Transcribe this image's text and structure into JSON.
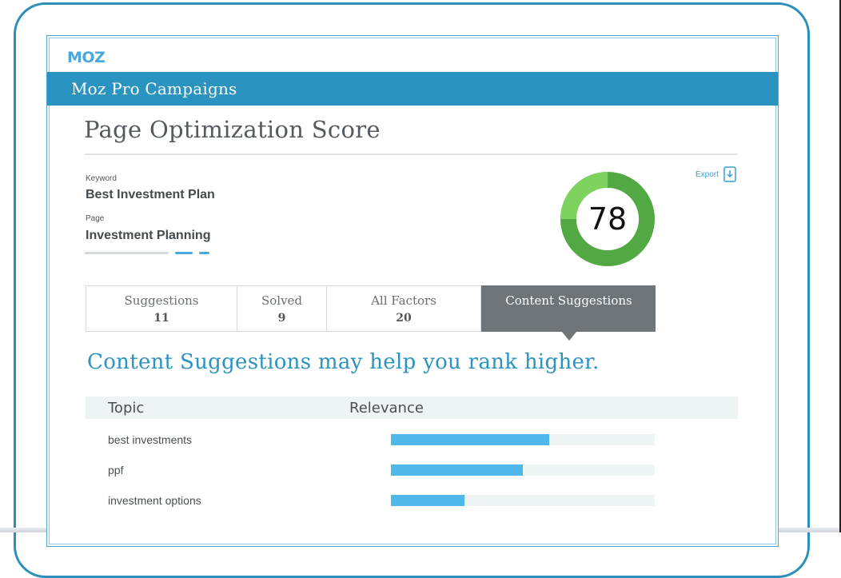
{
  "logo": "MOZ",
  "app_bar": {
    "title": "Moz Pro Campaigns"
  },
  "page_title": "Page Optimization Score",
  "export_label": "Export",
  "keyword": {
    "label": "Keyword",
    "value": "Best Investment Plan"
  },
  "page": {
    "label": "Page",
    "value": "Investment Planning"
  },
  "score": {
    "value": 78,
    "max": 100,
    "ring_color": "#52a944",
    "highlight_color": "#7ed35f"
  },
  "tabs": [
    {
      "label": "Suggestions",
      "count": "11"
    },
    {
      "label": "Solved",
      "count": "9"
    },
    {
      "label": "All Factors",
      "count": "20"
    },
    {
      "label": "Content Suggestions",
      "count": "",
      "active": true
    }
  ],
  "headline": "Content Suggestions may help you rank higher.",
  "table": {
    "headers": {
      "topic": "Topic",
      "relevance": "Relevance"
    },
    "rows": [
      {
        "topic": "best investments",
        "relevance": 0.6
      },
      {
        "topic": "ppf",
        "relevance": 0.5
      },
      {
        "topic": "investment options",
        "relevance": 0.28
      }
    ]
  },
  "colors": {
    "brand": "#2a93c0",
    "bar": "#4fb8e8",
    "tab_active": "#6f7478"
  }
}
